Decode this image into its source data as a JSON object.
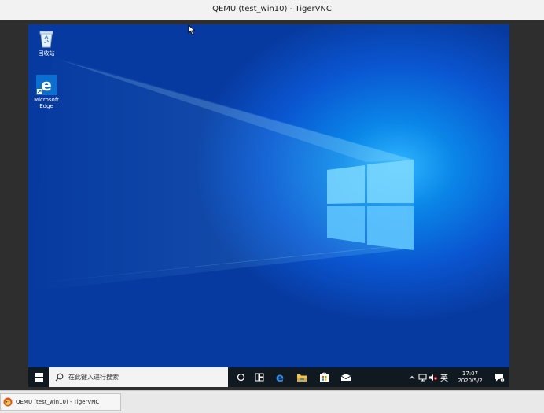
{
  "window": {
    "title": "QEMU (test_win10) - TigerVNC"
  },
  "desktop": {
    "icons": [
      {
        "label": "回收站",
        "icon": "recycle-bin-icon"
      },
      {
        "label": "Microsoft Edge",
        "icon": "edge-icon"
      }
    ]
  },
  "taskbar": {
    "search_placeholder": "在此键入进行搜索",
    "pinned": [
      "cortana-icon",
      "task-view-icon",
      "edge-icon",
      "file-explorer-icon",
      "store-icon",
      "mail-icon"
    ],
    "tray": {
      "ime": "英",
      "time": "17:07",
      "date": "2020/5/2",
      "notifications": "1"
    }
  },
  "host_taskbar": {
    "task_label": "QEMU (test_win10) - TigerVNC"
  },
  "colors": {
    "desktop_blue": "#0a55d0",
    "taskbar": "#101820"
  }
}
